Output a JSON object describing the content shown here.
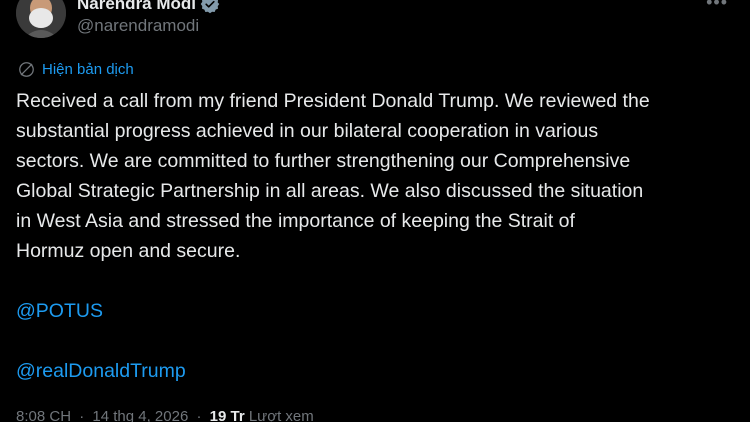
{
  "author": {
    "name": "Narendra Modi",
    "handle": "@narendramodi",
    "verified_color": "#829aab"
  },
  "translate": {
    "label": "Hiện bản dịch",
    "icon": "globe-icon"
  },
  "tweet": {
    "lines": [
      "Received a call from my friend President Donald Trump. We reviewed the",
      "substantial progress achieved in our bilateral cooperation in various",
      "sectors. We are committed to further strengthening our Comprehensive",
      "Global Strategic Partnership in all areas. We also discussed the situation",
      "in West Asia and stressed the importance of keeping the Strait of",
      "Hormuz open and secure."
    ],
    "mentions": [
      "@POTUS",
      "@realDonaldTrump"
    ]
  },
  "meta": {
    "time": "8:08 CH",
    "date": "14 thg 4, 2026",
    "separator": "·",
    "views_count": "19 Tr",
    "views_label": "Lượt xem"
  },
  "colors": {
    "background": "#000000",
    "text": "#e7e9ea",
    "secondary": "#71767b",
    "accent": "#1d9bf0"
  }
}
